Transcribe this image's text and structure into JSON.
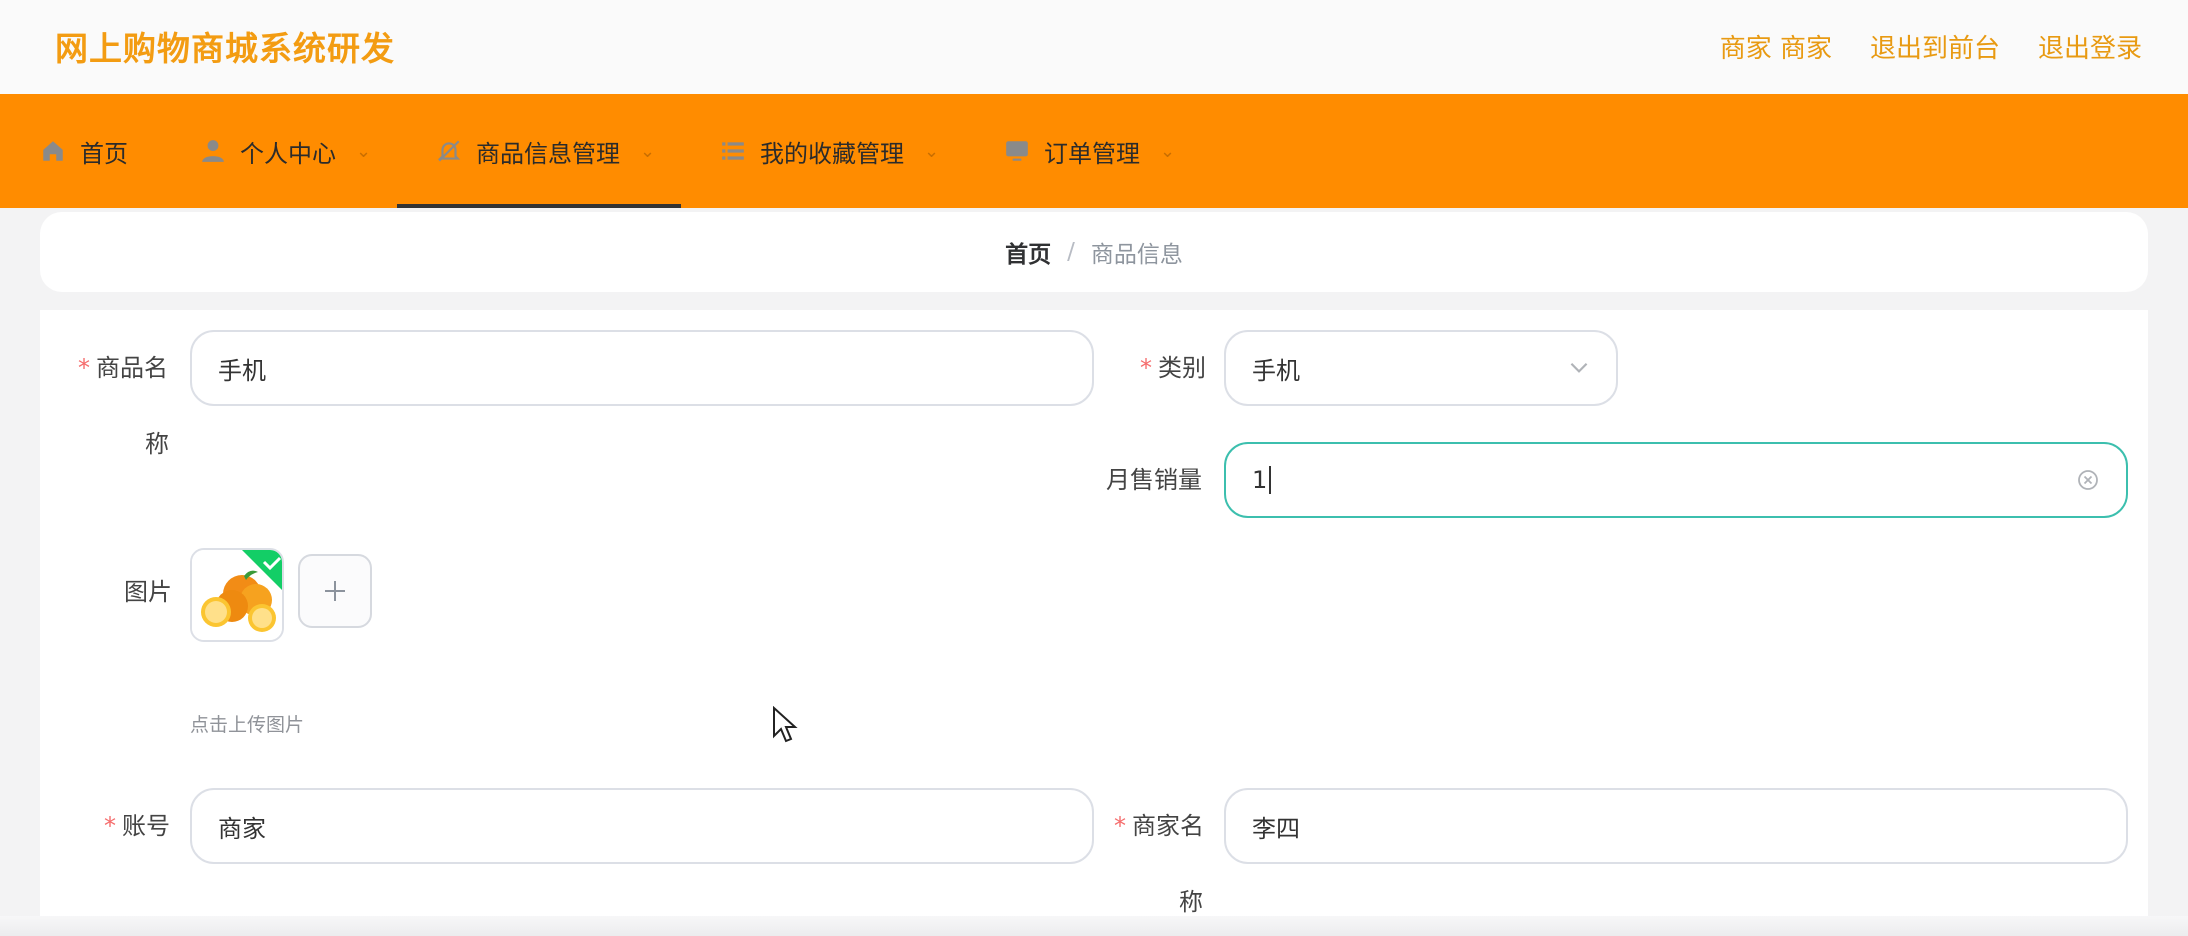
{
  "header": {
    "title": "网上购物商城系统研发",
    "links": [
      "商家 商家",
      "退出到前台",
      "退出登录"
    ]
  },
  "nav": {
    "items": [
      {
        "label": "首页",
        "icon": "home-icon"
      },
      {
        "label": "个人中心",
        "icon": "user-icon"
      },
      {
        "label": "商品信息管理",
        "icon": "bell-off-icon"
      },
      {
        "label": "我的收藏管理",
        "icon": "list-icon"
      },
      {
        "label": "订单管理",
        "icon": "monitor-icon"
      }
    ],
    "active_index": 2,
    "chevron": "⌄"
  },
  "breadcrumb": {
    "home": "首页",
    "separator": "/",
    "current": "商品信息"
  },
  "form": {
    "product_name": {
      "label_line1": "商品名",
      "label_line2": "称",
      "value": "手机",
      "required": "*"
    },
    "category": {
      "label": "类别",
      "value": "手机",
      "required": "*"
    },
    "monthly_sales": {
      "label": "月售销量",
      "value": "1"
    },
    "image": {
      "label": "图片",
      "hint": "点击上传图片",
      "add_symbol": "+"
    },
    "account": {
      "label": "账号",
      "value": "商家",
      "required": "*"
    },
    "merchant_name": {
      "label_line1": "商家名",
      "label_line2": "称",
      "value": "李四",
      "required": "*"
    }
  },
  "colors": {
    "accent": "#ff8c00",
    "title": "#f39c12",
    "focus": "#3cbfae",
    "required": "#f56c6c"
  }
}
